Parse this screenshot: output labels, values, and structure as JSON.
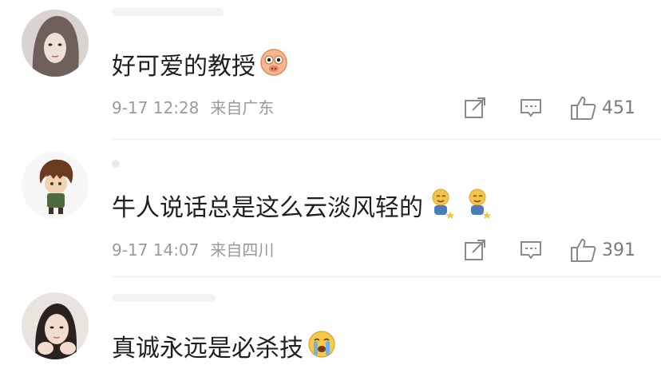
{
  "comments": [
    {
      "text": "好可爱的教授",
      "emoji": "pig-nose-emoji",
      "time": "9-17 12:28",
      "location": "来自广东",
      "likes": "451"
    },
    {
      "text": "牛人说话总是这么云淡风轻的",
      "emoji": "smiling-sitting-emoji",
      "time": "9-17 14:07",
      "location": "来自四川",
      "likes": "391"
    },
    {
      "text": "真诚永远是必杀技",
      "emoji": "crying-face-emoji"
    }
  ],
  "icons": {
    "share": "share-icon",
    "comment": "comment-icon",
    "like": "thumbs-up-icon"
  },
  "colors": {
    "text": "#1f1f1f",
    "meta": "#9a9a9a",
    "icon": "#8a8a8a"
  }
}
